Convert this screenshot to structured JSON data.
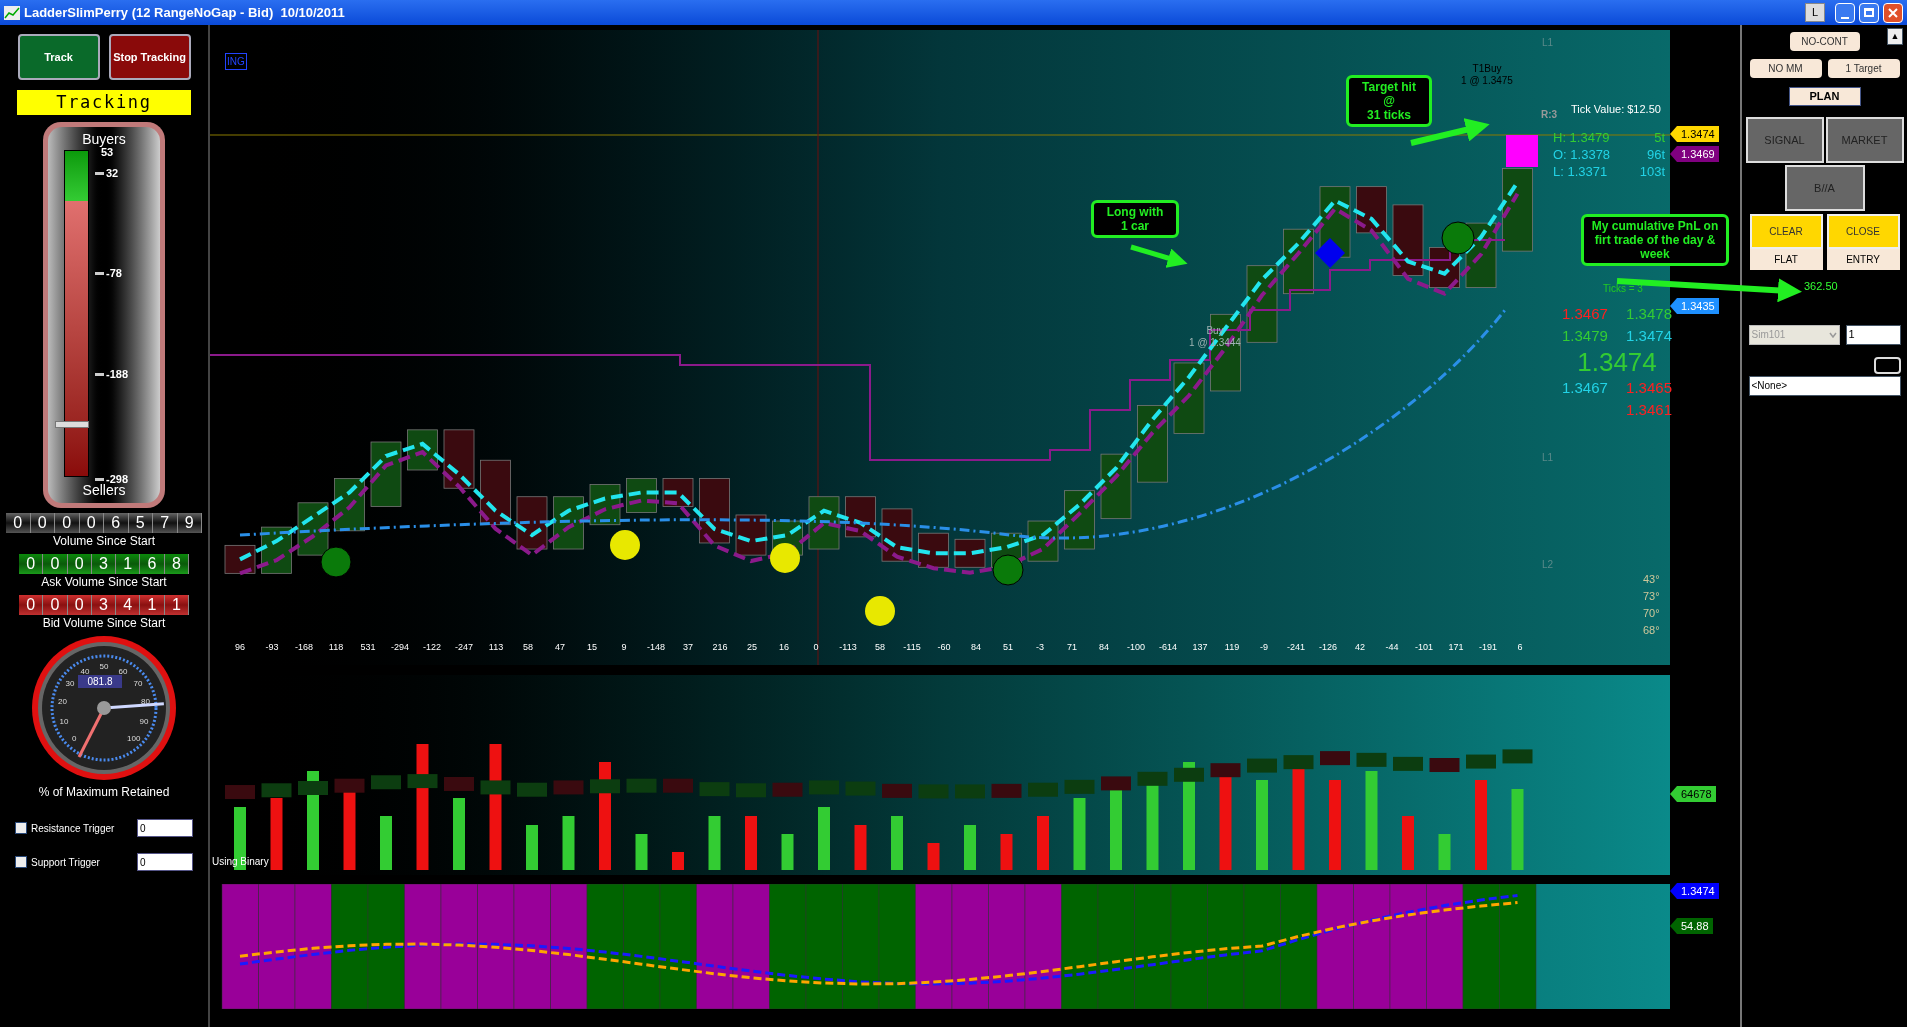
{
  "window": {
    "title": "LadderSlimPerry (12 RangeNoGap - Bid)  10/10/2011",
    "controls": [
      "L"
    ]
  },
  "left_panel": {
    "buttons": [
      {
        "label": "Track",
        "kind": "go"
      },
      {
        "label": "Stop Tracking",
        "kind": "stop"
      }
    ],
    "status": "Tracking",
    "meter": {
      "title": "Buyers",
      "footer": "Sellers",
      "top_value": "53",
      "ticks": [
        "32",
        "-78",
        "-188",
        "-298"
      ],
      "level": 0.16
    },
    "counters": [
      {
        "kind": "total",
        "digits": [
          "0",
          "0",
          "0",
          "0",
          "6",
          "5",
          "7",
          "9"
        ],
        "label": "Volume Since Start"
      },
      {
        "kind": "ask",
        "digits": [
          "0",
          "0",
          "0",
          "3",
          "1",
          "6",
          "8"
        ],
        "label": "Ask Volume Since Start"
      },
      {
        "kind": "bid",
        "digits": [
          "0",
          "0",
          "0",
          "3",
          "4",
          "1",
          "1"
        ],
        "label": "Bid Volume Since Start"
      }
    ],
    "gauge": {
      "reading": "081.8",
      "scale": [
        "0",
        "10",
        "20",
        "30",
        "40",
        "50",
        "60",
        "70",
        "80",
        "90",
        "100"
      ],
      "label": "% of Maximum Retained"
    },
    "triggers": [
      {
        "label": "Resistance Trigger",
        "checked": false,
        "value": "0"
      },
      {
        "label": "Support Trigger",
        "checked": false,
        "value": "0"
      }
    ]
  },
  "chart": {
    "indicator_label": "ING",
    "level_labels": [
      "L1",
      "L1",
      "L2"
    ],
    "x_labels": [
      "96",
      "-93",
      "-168",
      "118",
      "531",
      "-294",
      "-122",
      "-247",
      "113",
      "58",
      "47",
      "15",
      "9",
      "-148",
      "37",
      "216",
      "25",
      "16",
      "0",
      "-113",
      "58",
      "-115",
      "-60",
      "84",
      "51",
      "-3",
      "71",
      "84",
      "-100",
      "-614",
      "137",
      "119",
      "-9",
      "-241",
      "-126",
      "42",
      "-44",
      "-101",
      "171",
      "-191",
      "6"
    ],
    "callouts": [
      {
        "kind": "target",
        "text": "Target hit\n@\n31 ticks"
      },
      {
        "kind": "entry",
        "text": "Long with\n1 car"
      },
      {
        "kind": "pnl",
        "text": "My cumulative PnL on firt trade of the day & week"
      }
    ],
    "trades": [
      {
        "kind": "exit",
        "name": "T1Buy",
        "detail": "1 @ 1.3475"
      },
      {
        "kind": "entry",
        "name": "Buy",
        "detail": "1 @ 1.3444"
      }
    ],
    "tick_value": "Tick Value: $12.50",
    "ratio": "R:3",
    "hol": [
      {
        "label": "H: 1.3479",
        "ticks": "5t",
        "color": "#33cc33"
      },
      {
        "label": "O: 1.3378",
        "ticks": "96t",
        "color": "#22d3e6"
      },
      {
        "label": "L: 1.3371",
        "ticks": "103t",
        "color": "#22d3e6"
      }
    ],
    "ticks_note": "Ticks = 3",
    "ladder": [
      {
        "kind": "pair",
        "cells": [
          {
            "text": "1.3467",
            "color": "#ff2020"
          },
          {
            "text": "1.3478",
            "color": "#33cc33"
          }
        ]
      },
      {
        "kind": "pair",
        "cells": [
          {
            "text": "1.3479",
            "color": "#33cc33"
          },
          {
            "text": "1.3474",
            "color": "#22d3e6"
          }
        ]
      },
      {
        "kind": "last",
        "cells": [
          {
            "text": "1.3474",
            "color": "#33cc33"
          }
        ]
      },
      {
        "kind": "pair",
        "cells": [
          {
            "text": "1.3467",
            "color": "#22d3e6"
          },
          {
            "text": "1.3465",
            "color": "#ff2020"
          }
        ]
      },
      {
        "kind": "right",
        "cells": [
          {
            "text": "1.3461",
            "color": "#ff2020"
          }
        ]
      }
    ],
    "angles": [
      "43°",
      "73°",
      "70°",
      "68°"
    ],
    "price_pane_tags": [
      {
        "text": "1.3474",
        "color": "#ffd700"
      },
      {
        "text": "1.3469",
        "color": "#800080"
      },
      {
        "text": "1.3435",
        "color": "#1e90ff"
      }
    ],
    "volume_pane_tags": [
      {
        "text": "64678",
        "color": "#33cc33"
      }
    ],
    "oscillator_pane_tags": [
      {
        "text": "1.3474",
        "color": "#0000ff"
      },
      {
        "text": "54.88",
        "color": "#006400"
      }
    ],
    "volume_label": "Using Binary"
  },
  "right_panel": {
    "scroll_up": "▲",
    "mode": "NO-CONT",
    "options": [
      "NO MM",
      "1 Target"
    ],
    "plan": "PLAN",
    "order_buttons": [
      {
        "label": "SIGNAL",
        "kind": "gray"
      },
      {
        "label": "MARKET",
        "kind": "gray"
      },
      {
        "label": "B//A",
        "kind": "gray"
      }
    ],
    "action_buttons": [
      {
        "label": "CLEAR",
        "kind": "yellow"
      },
      {
        "label": "CLOSE",
        "kind": "yellow"
      },
      {
        "label": "FLAT",
        "kind": "beige"
      },
      {
        "label": "ENTRY",
        "kind": "beige"
      }
    ],
    "pnl": "362.50",
    "account": {
      "value": "Sim101",
      "disabled": true
    },
    "quantity": "1",
    "strategy": "<None>"
  }
}
